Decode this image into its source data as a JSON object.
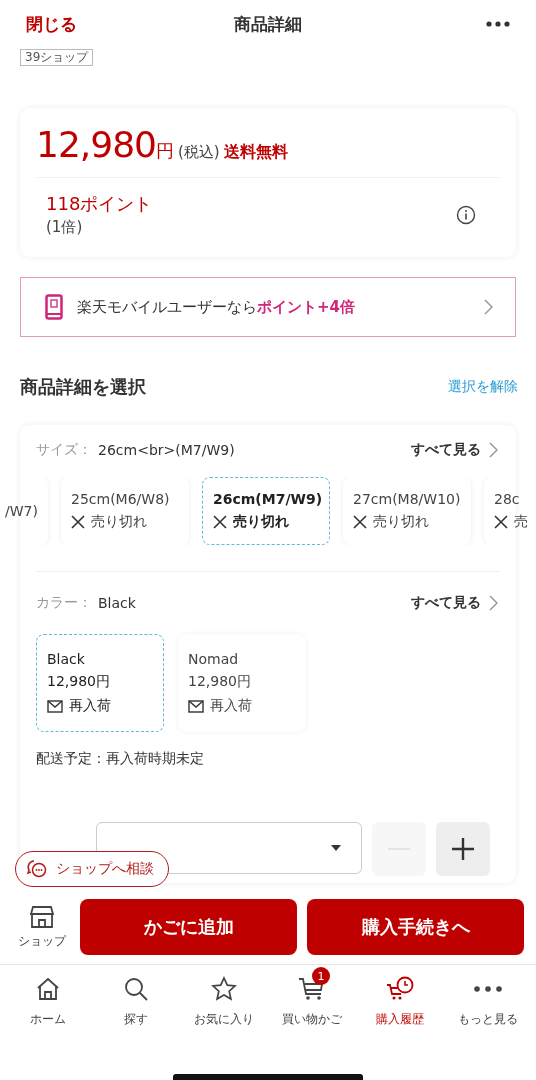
{
  "header": {
    "close": "閉じる",
    "title": "商品詳細"
  },
  "shop_tag": "39ショップ",
  "price": {
    "amount": "12,980",
    "unit": "円",
    "tax": "(税込)",
    "shipping": "送料無料",
    "points": "118ポイント",
    "multiplier": "(1倍)"
  },
  "banner": {
    "text": "楽天モバイルユーザーなら",
    "highlight": "ポイント+4倍"
  },
  "section": {
    "title": "商品詳細を選択",
    "clear": "選択を解除"
  },
  "size": {
    "label": "サイズ：",
    "value": "26cm<br>(M7/W9)",
    "see_all": "すべて見る",
    "options": [
      {
        "label": "/W7)",
        "selected": false
      },
      {
        "label": "25cm(M6/W8)",
        "status": "売り切れ",
        "selected": false
      },
      {
        "label": "26cm(M7/W9)",
        "status": "売り切れ",
        "selected": true
      },
      {
        "label": "27cm(M8/W10)",
        "status": "売り切れ",
        "selected": false
      },
      {
        "label": "28c",
        "status": "売",
        "selected": false
      }
    ]
  },
  "color": {
    "label": "カラー：",
    "value": "Black",
    "see_all": "すべて見る",
    "options": [
      {
        "name": "Black",
        "price": "12,980円",
        "restock": "再入荷",
        "selected": true
      },
      {
        "name": "Nomad",
        "price": "12,980円",
        "restock": "再入荷",
        "selected": false
      }
    ]
  },
  "delivery": "配送予定：再入荷時期未定",
  "quantity": {
    "minus_disabled": true
  },
  "consult": "ショップへ相談",
  "actions": {
    "shop": "ショップ",
    "add_to_cart": "かごに追加",
    "checkout": "購入手続きへ"
  },
  "tabs": [
    {
      "kind": "home",
      "label": "ホーム",
      "selected": false
    },
    {
      "kind": "search",
      "label": "探す",
      "selected": false
    },
    {
      "kind": "star",
      "label": "お気に入り",
      "selected": false
    },
    {
      "kind": "cart",
      "label": "買い物かご",
      "badge": "1",
      "selected": false
    },
    {
      "kind": "history",
      "label": "購入履歴",
      "selected": true
    },
    {
      "kind": "more",
      "label": "もっと見る",
      "selected": false
    }
  ]
}
